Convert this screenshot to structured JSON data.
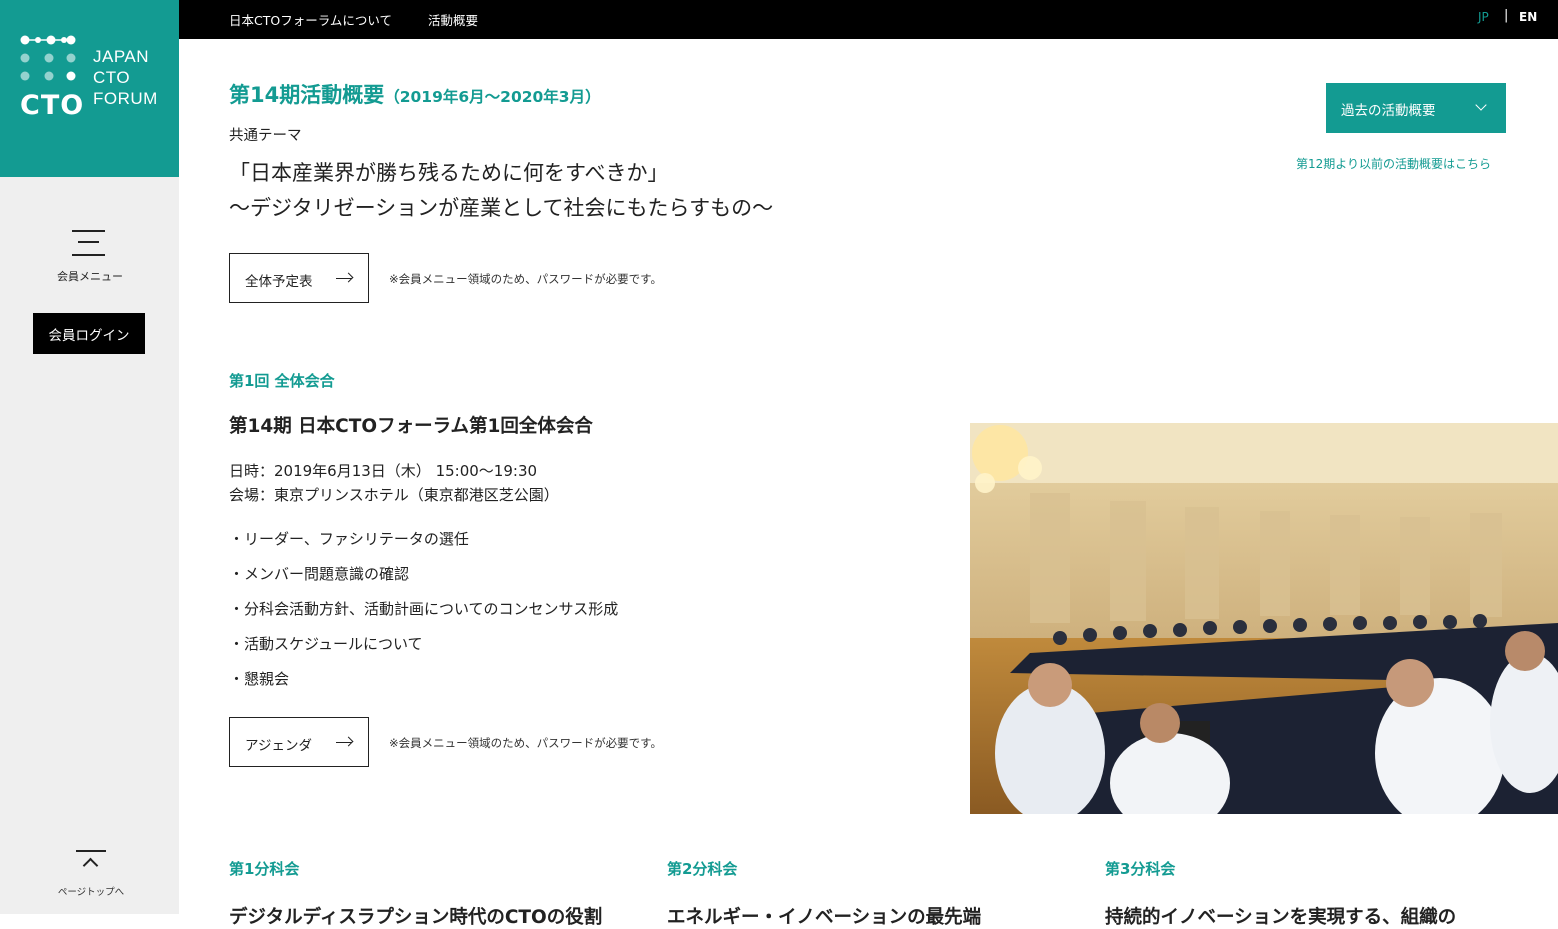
{
  "sidebar": {
    "logo": {
      "mark": "CTO",
      "lines": [
        "JAPAN",
        "CTO",
        "FORUM"
      ]
    },
    "member_menu_label": "会員メニュー",
    "login_label": "会員ログイン",
    "page_top_label": "ページトップへ"
  },
  "topbar": {
    "nav": [
      "日本CTOフォーラムについて",
      "活動概要"
    ],
    "lang_jp": "JP",
    "lang_sep": "|",
    "lang_en": "EN"
  },
  "header": {
    "title": "第14期活動概要",
    "title_sub": "（2019年6月～2020年3月）",
    "theme_label": "共通テーマ",
    "theme_line1": "「日本産業界が勝ち残るために何をすべきか」",
    "theme_line2": "～デジタリゼーションが産業として社会にもたらすもの～",
    "schedule_button": "全体予定表",
    "password_note": "※会員メニュー領域のため、パスワードが必要です。",
    "past_button": "過去の活動概要",
    "past_link": "第12期より以前の活動概要はこちら"
  },
  "meeting": {
    "label": "第1回 全体会合",
    "title": "第14期 日本CTOフォーラム第1回全体会合",
    "date": "日時：2019年6月13日（木） 15:00～19:30",
    "venue": "会場：東京プリンスホテル（東京都港区芝公園）",
    "items": [
      "・リーダー、ファシリテータの選任",
      "・メンバー問題意識の確認",
      "・分科会活動方針、活動計画についてのコンセンサス形成",
      "・活動スケジュールについて",
      "・懇親会"
    ],
    "agenda_button": "アジェンダ",
    "password_note": "※会員メニュー領域のため、パスワードが必要です。"
  },
  "subcommittees": [
    {
      "label": "第1分科会",
      "title": "デジタルディスラプション時代のCTOの役割"
    },
    {
      "label": "第2分科会",
      "title": "エネルギー・イノベーションの最先端"
    },
    {
      "label": "第3分科会",
      "title": "持続的イノベーションを実現する、組織の"
    }
  ],
  "colors": {
    "accent": "#139b92",
    "topbar": "#000000",
    "sidebar": "#efefef"
  },
  "icons": [
    "menu-icon",
    "arrow-right-icon",
    "chevron-down-icon",
    "chevron-up-icon"
  ]
}
